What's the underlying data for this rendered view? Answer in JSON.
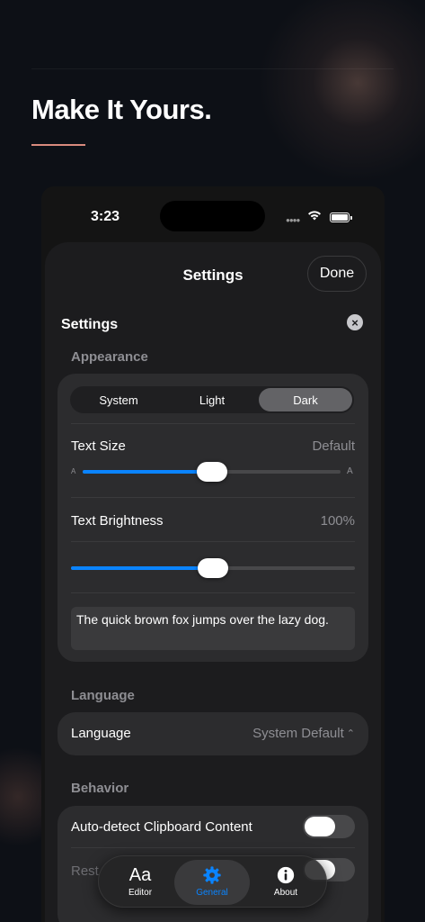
{
  "headline": "Make It Yours.",
  "accent_color": "#d98a7d",
  "status_bar": {
    "time": "3:23",
    "icons": [
      "cellular-icon",
      "wifi-icon",
      "battery-icon"
    ]
  },
  "sheet": {
    "title": "Settings",
    "done_label": "Done"
  },
  "panel": {
    "title": "Settings",
    "close_icon": "close-icon"
  },
  "appearance": {
    "header": "Appearance",
    "modes": [
      "System",
      "Light",
      "Dark"
    ],
    "selected_mode": "Dark",
    "text_size": {
      "label": "Text Size",
      "value": "Default",
      "small_glyph": "A",
      "large_glyph": "A",
      "level": 0.5
    },
    "text_brightness": {
      "label": "Text Brightness",
      "value": "100%",
      "level": 0.5
    },
    "preview_text": "The quick brown fox jumps over the lazy dog."
  },
  "language": {
    "header": "Language",
    "label": "Language",
    "value": "System Default",
    "chevron": "⌃⌄"
  },
  "behavior": {
    "header": "Behavior",
    "items": [
      {
        "label": "Auto-detect Clipboard Content",
        "on": false
      },
      {
        "label": "Rest",
        "on": false
      }
    ]
  },
  "tab_bar": {
    "tabs": [
      {
        "label": "Editor",
        "icon": "Aa"
      },
      {
        "label": "General",
        "icon": "gear-icon"
      },
      {
        "label": "About",
        "icon": "info-icon"
      }
    ],
    "active": "General",
    "active_color": "#0a84ff"
  }
}
